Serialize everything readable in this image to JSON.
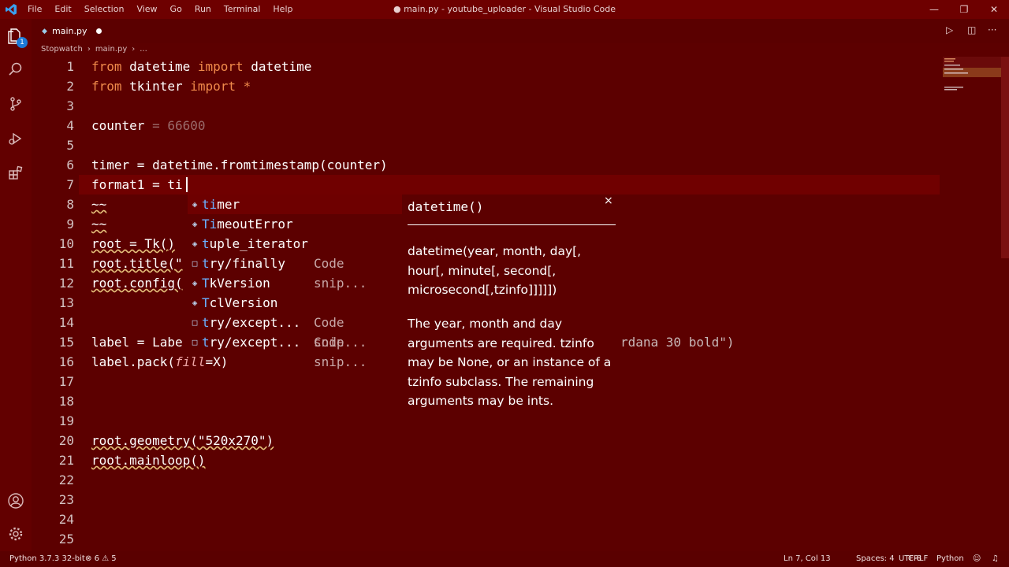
{
  "window": {
    "title": "● main.py - youtube_uploader - Visual Studio Code",
    "menu": [
      "File",
      "Edit",
      "Selection",
      "View",
      "Go",
      "Run",
      "Terminal",
      "Help"
    ],
    "controls": [
      "—",
      "❐",
      "✕"
    ]
  },
  "activity_bar": {
    "icons": [
      "files-icon",
      "search-icon",
      "source-control-icon",
      "run-debug-icon",
      "extensions-icon"
    ],
    "explorer_badge": "1",
    "bottom_icons": [
      "account-icon",
      "settings-gear-icon"
    ]
  },
  "tab": {
    "label": "main.py",
    "modified": true
  },
  "breadcrumb": [
    "Stopwatch",
    "›",
    "main.py",
    "›",
    "..."
  ],
  "line_numbers": [
    "1",
    "2",
    "3",
    "4",
    "5",
    "6",
    "7",
    "8",
    "9",
    "10",
    "11",
    "12",
    "13",
    "14",
    "15",
    "16",
    "17",
    "18",
    "19",
    "20",
    "21",
    "22",
    "23",
    "24",
    "25"
  ],
  "code": {
    "l1a": "from",
    "l1b": " datetime ",
    "l1c": "import",
    "l1d": " datetime",
    "l2a": "from",
    "l2b": " tkinter ",
    "l2c": "import",
    "l2d": " *",
    "l4a": "counter",
    "l4b": " = ",
    "l4c": "66600",
    "l6": "timer = datetime.fromtimestamp(counter)",
    "l7": "format1 = ti",
    "l8": "~~",
    "l9": "~~",
    "l10": "root = Tk()",
    "l11": "root.title(\"",
    "l12": "root.config(",
    "l15a": "label = Labe",
    "l15b": "rdana 30 bold\")",
    "l16a": "label.pack(",
    "l16b": "fill",
    "l16c": "=X)",
    "l20": "root.geometry(\"520x270\")",
    "l21": "root.mainloop()"
  },
  "suggestions": [
    {
      "icon": "◈",
      "pre": "ti",
      "rest": "mer",
      "detail": ""
    },
    {
      "icon": "◈",
      "pre": "Ti",
      "rest": "meoutError",
      "detail": ""
    },
    {
      "icon": "◈",
      "pre": "t",
      "rest": "uple_iterator",
      "detail": ""
    },
    {
      "icon": "□",
      "pre": "t",
      "rest": "ry/finally",
      "detail": "Code snip..."
    },
    {
      "icon": "◈",
      "pre": "T",
      "rest": "kVersion",
      "detail": ""
    },
    {
      "icon": "◈",
      "pre": "T",
      "rest": "clVersion",
      "detail": ""
    },
    {
      "icon": "□",
      "pre": "t",
      "rest": "ry/except...",
      "detail": "Code snip..."
    },
    {
      "icon": "□",
      "pre": "t",
      "rest": "ry/except...",
      "detail": "Code snip..."
    }
  ],
  "doc": {
    "signature": "datetime()",
    "close": "×",
    "detail": "datetime(year, month, day[, hour[, minute[, second[, microsecond[,tzinfo]]]]])",
    "description": "The year, month and day arguments are required. tzinfo may be None, or an instance of a tzinfo subclass. The remaining arguments may be ints."
  },
  "statusbar": {
    "interpreter": "Python 3.7.3 32-bit",
    "errors": "6",
    "warnings": "5",
    "position": "Ln 7, Col 13",
    "spaces": "Spaces: 4",
    "encoding": "UTF-8",
    "eol": "CRLF",
    "language": "Python"
  },
  "colors": {
    "bg": "#5c0000",
    "keyword": "#f08a4b",
    "match": "#6ab0ff"
  }
}
